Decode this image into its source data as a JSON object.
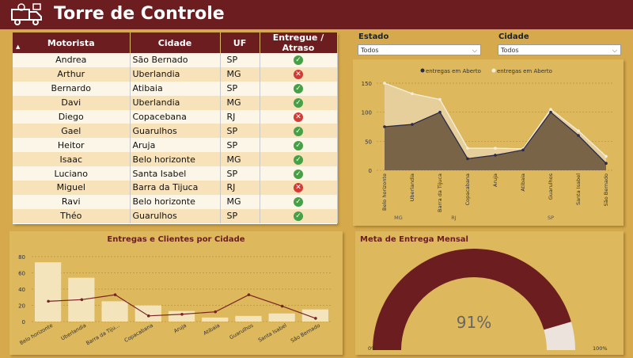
{
  "header": {
    "title": "Torre de Controle",
    "logo_icon": "delivery-truck-icon"
  },
  "table": {
    "columns": [
      "Motorista",
      "Cidade",
      "UF",
      "Entregue / Atraso"
    ],
    "rows": [
      {
        "motorista": "Andrea",
        "cidade": "São Bernado",
        "uf": "SP",
        "status": "ok"
      },
      {
        "motorista": "Arthur",
        "cidade": "Uberlandia",
        "uf": "MG",
        "status": "late"
      },
      {
        "motorista": "Bernardo",
        "cidade": "Atibaia",
        "uf": "SP",
        "status": "ok"
      },
      {
        "motorista": "Davi",
        "cidade": "Uberlandia",
        "uf": "MG",
        "status": "ok"
      },
      {
        "motorista": "Diego",
        "cidade": "Copacebana",
        "uf": "RJ",
        "status": "late"
      },
      {
        "motorista": "Gael",
        "cidade": "Guarulhos",
        "uf": "SP",
        "status": "ok"
      },
      {
        "motorista": "Heitor",
        "cidade": "Aruja",
        "uf": "SP",
        "status": "ok"
      },
      {
        "motorista": "Isaac",
        "cidade": "Belo horizonte",
        "uf": "MG",
        "status": "ok"
      },
      {
        "motorista": "Luciano",
        "cidade": "Santa Isabel",
        "uf": "SP",
        "status": "ok"
      },
      {
        "motorista": "Miguel",
        "cidade": "Barra da Tijuca",
        "uf": "RJ",
        "status": "late"
      },
      {
        "motorista": "Ravi",
        "cidade": "Belo horizonte",
        "uf": "MG",
        "status": "ok"
      },
      {
        "motorista": "Théo",
        "cidade": "Guarulhos",
        "uf": "SP",
        "status": "ok"
      }
    ],
    "status_colors": {
      "ok": "#46a046",
      "late": "#d23b36"
    }
  },
  "filters": {
    "estado": {
      "label": "Estado",
      "value": "Todos"
    },
    "cidade": {
      "label": "Cidade",
      "value": "Todos"
    }
  },
  "chart_data": [
    {
      "type": "area",
      "legend": [
        "entregas em Aberto",
        "entregas em Aberto"
      ],
      "legend_position": "top-center",
      "categories": [
        "Belo horizonte",
        "Uberlandia",
        "Barra da Tijuca",
        "Copacabana",
        "Aruja",
        "Atibaia",
        "Guarulhos",
        "Santa Isabel",
        "São Bernado"
      ],
      "group_labels": [
        "MG",
        "RJ",
        "SP"
      ],
      "ylim": [
        0,
        150
      ],
      "yticks": [
        0,
        50,
        100,
        150
      ],
      "series": [
        {
          "color": "#2a2a4a",
          "fill": "#7a6448",
          "values": [
            75,
            79,
            100,
            20,
            26,
            35,
            100,
            60,
            12
          ]
        },
        {
          "color": "#f5efe0",
          "fill": "#e6cf9b",
          "values": [
            150,
            132,
            122,
            38,
            38,
            37,
            105,
            68,
            24
          ]
        }
      ]
    },
    {
      "type": "bar",
      "title": "Entregas e Clientes por Cidade",
      "categories": [
        "Belo horizonte",
        "Uberlandia",
        "Barra da Tiju...",
        "Copacabana",
        "Aruja",
        "Atibaia",
        "Guarulhos",
        "Santa Isabel",
        "São Bernado"
      ],
      "ylim": [
        0,
        80
      ],
      "yticks": [
        0,
        20,
        40,
        60,
        80
      ],
      "bars": [
        73,
        54,
        25,
        20,
        13,
        5,
        7,
        10,
        15
      ],
      "line": [
        25,
        27,
        33,
        7,
        9,
        12,
        33,
        19,
        4
      ],
      "bar_color": "#f4e4bb",
      "line_color": "#7a2326"
    },
    {
      "type": "gauge",
      "title": "Meta de Entrega Mensal",
      "value": 91,
      "value_label": "91%",
      "min_label": "0%",
      "max_label": "100%",
      "fill_color": "#6b1d1f",
      "rest_color": "#ece4dc"
    }
  ]
}
